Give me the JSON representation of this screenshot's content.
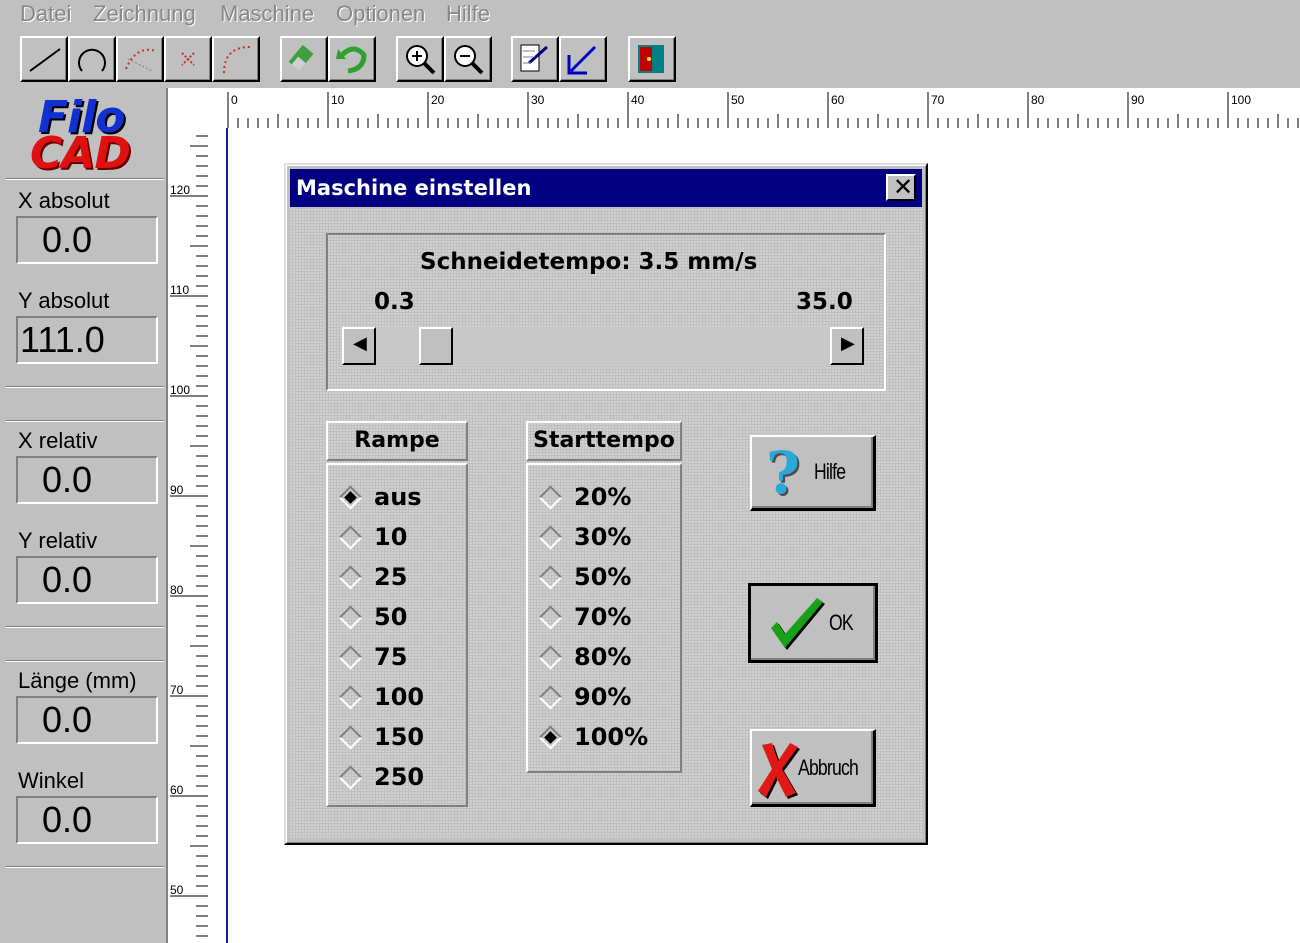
{
  "menu": {
    "items": [
      "Datei",
      "Zeichnung",
      "Maschine",
      "Optionen",
      "Hilfe"
    ]
  },
  "toolbar": {
    "groups": [
      [
        "line-icon",
        "arc-icon",
        "dotted-curve-icon",
        "cross-point-icon",
        "dotted-arc-icon"
      ],
      [
        "eraser-icon",
        "undo-icon"
      ],
      [
        "zoom-in-icon",
        "zoom-out-icon"
      ],
      [
        "pen-edit-icon",
        "arrow-cut-icon"
      ],
      [
        "exit-door-icon"
      ]
    ]
  },
  "logo": {
    "line1": "Filo",
    "line2": "CAD"
  },
  "left_panel": {
    "x_absolut_label": "X absolut",
    "x_absolut_value": "0.0",
    "y_absolut_label": "Y absolut",
    "y_absolut_value": "111.0",
    "x_relativ_label": "X  relativ",
    "x_relativ_value": "0.0",
    "y_relativ_label": "Y  relativ",
    "y_relativ_value": "0.0",
    "laenge_label": "Länge (mm)",
    "laenge_value": "0.0",
    "winkel_label": "Winkel",
    "winkel_value": "0.0"
  },
  "rulers": {
    "horizontal_labels": [
      "0",
      "10",
      "20",
      "30",
      "40",
      "50",
      "60",
      "70",
      "80",
      "90",
      "100"
    ],
    "vertical_labels": [
      "120",
      "110",
      "100",
      "90",
      "80",
      "70",
      "60",
      "50"
    ]
  },
  "dialog": {
    "title": "Maschine einstellen",
    "close_glyph": "✕",
    "speed_label": "Schneidetempo:  3.5  mm/s",
    "speed_min": "0.3",
    "speed_max": "35.0",
    "speed_value": 3.5,
    "rampe": {
      "header": "Rampe",
      "options": [
        "aus",
        "10",
        "25",
        "50",
        "75",
        "100",
        "150",
        "250"
      ],
      "selected": "aus"
    },
    "starttempo": {
      "header": "Starttempo",
      "options": [
        "20%",
        "30%",
        "50%",
        "70%",
        "80%",
        "90%",
        "100%"
      ],
      "selected": "100%"
    },
    "buttons": {
      "hilfe": "Hilfe",
      "ok": "OK",
      "abbruch": "Abbruch"
    }
  }
}
